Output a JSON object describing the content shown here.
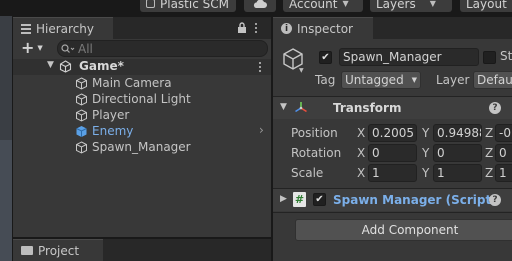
{
  "toolbar": {
    "plastic_label": "Plastic SCM",
    "account_label": "Account",
    "layers_label": "Layers",
    "layout_label": "Layout"
  },
  "hierarchy": {
    "tab_label": "Hierarchy",
    "add_label": "+",
    "search_placeholder": "All",
    "scene_name": "Game*",
    "items": [
      {
        "label": "Main Camera",
        "selected": false
      },
      {
        "label": "Directional Light",
        "selected": false
      },
      {
        "label": "Player",
        "selected": false
      },
      {
        "label": "Enemy",
        "selected": false,
        "prefab": true
      },
      {
        "label": "Spawn_Manager",
        "selected": true
      }
    ]
  },
  "project": {
    "tab_label": "Project"
  },
  "inspector": {
    "tab_label": "Inspector",
    "object_name": "Spawn_Manager",
    "static_label": "St",
    "tag_label": "Tag",
    "tag_value": "Untagged",
    "layer_label": "Layer",
    "layer_value": "Defaul",
    "transform": {
      "title": "Transform",
      "position_label": "Position",
      "rotation_label": "Rotation",
      "scale_label": "Scale",
      "position": {
        "x": "0.2005",
        "y": "0.94988",
        "z": "-0"
      },
      "rotation": {
        "x": "0",
        "y": "0",
        "z": "0"
      },
      "scale": {
        "x": "1",
        "y": "1",
        "z": "1"
      }
    },
    "script": {
      "title": "Spawn Manager (Script)"
    },
    "add_component_label": "Add Component"
  },
  "axes": {
    "x": "X",
    "y": "Y",
    "z": "Z"
  },
  "colors": {
    "accent_selected": "#2c5d87",
    "prefab_text": "#7bafe9",
    "bg_panel": "#383838",
    "bg_dark": "#191919"
  }
}
